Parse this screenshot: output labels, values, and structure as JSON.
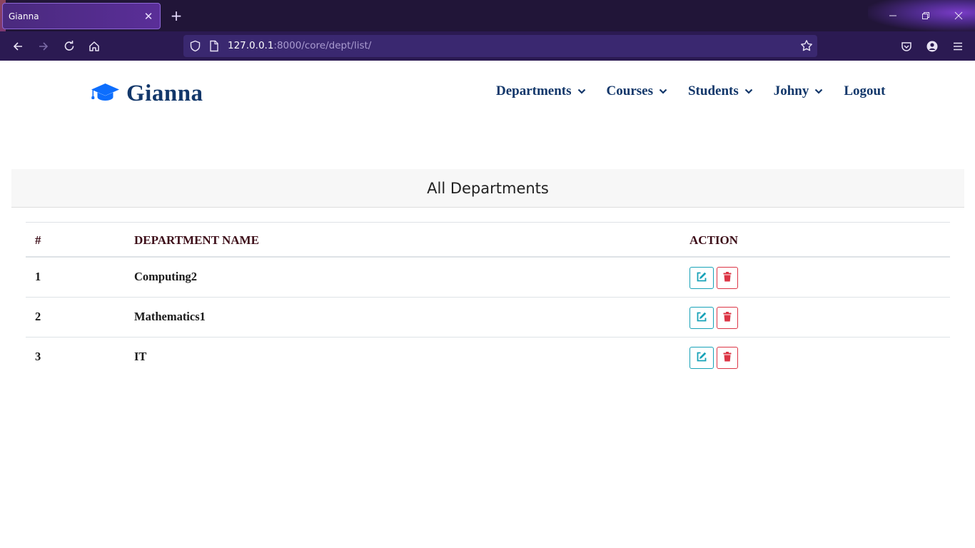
{
  "browser": {
    "tab_title": "Gianna",
    "url_host": "127.0.0.1",
    "url_rest": ":8000/core/dept/list/",
    "icons": [
      "close-icon",
      "plus-icon",
      "back-icon",
      "forward-icon",
      "reload-icon",
      "home-icon",
      "shield-icon",
      "page-icon",
      "star-icon",
      "pocket-icon",
      "account-icon",
      "menu-icon",
      "minimize-icon",
      "restore-icon",
      "window-close-icon"
    ],
    "colors": {
      "tabbar": "#211538",
      "navbar": "#2b1a52",
      "urlbar": "#3a2870"
    }
  },
  "site": {
    "brand": "Gianna",
    "brand_icon": "graduation-cap-icon",
    "brand_color": "#12376a",
    "icon_color": "#0d6efd",
    "nav": [
      {
        "label": "Departments",
        "dropdown": true
      },
      {
        "label": "Courses",
        "dropdown": true
      },
      {
        "label": "Students",
        "dropdown": true
      },
      {
        "label": "Johny",
        "dropdown": true
      },
      {
        "label": "Logout",
        "dropdown": false
      }
    ]
  },
  "card": {
    "title": "All Departments"
  },
  "table": {
    "columns": [
      "#",
      "DEPARTMENT NAME",
      "ACTION"
    ],
    "rows": [
      {
        "num": "1",
        "name": "Computing2"
      },
      {
        "num": "2",
        "name": "Mathematics1"
      },
      {
        "num": "3",
        "name": "IT"
      }
    ],
    "colors": {
      "edit": "#17a2b8",
      "delete": "#dc3545",
      "header_text": "#3c0d18"
    }
  }
}
